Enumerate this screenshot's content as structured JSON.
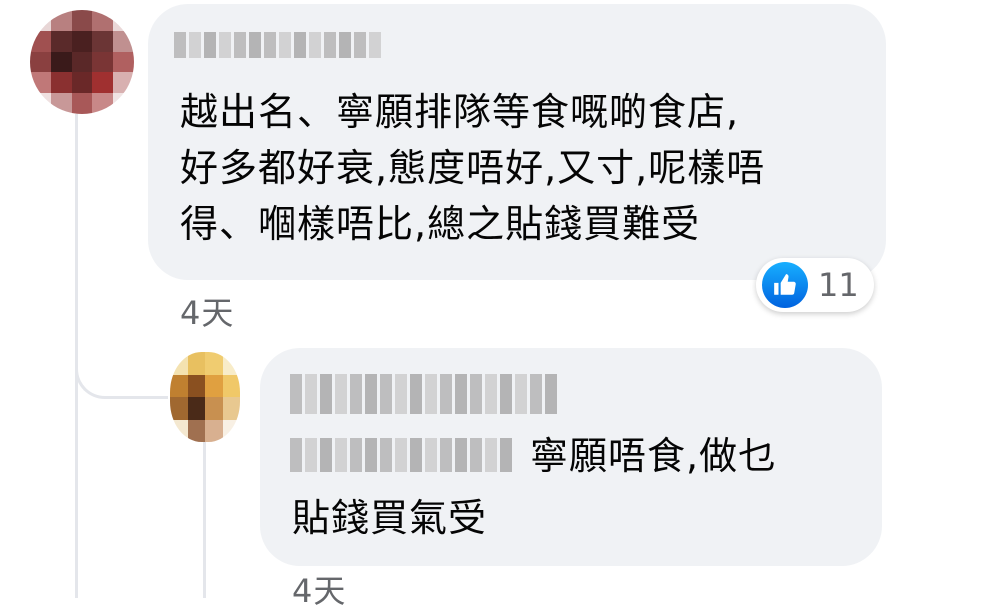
{
  "comments": [
    {
      "author": "",
      "text_lines": [
        "越出名、寧願排隊等食嘅啲食店,",
        "好多都好衰,態度唔好,又寸,呢樣唔",
        "得、嗰樣唔比,總之貼錢買難受"
      ],
      "timestamp": "4天",
      "reactions": {
        "icon": "like-icon",
        "count": "11"
      }
    },
    {
      "author": "",
      "text_lines": [
        "寧願唔食,做乜",
        "貼錢買氣受"
      ],
      "timestamp": "4天"
    }
  ],
  "colors": {
    "bubble": "#f0f2f5",
    "timestamp": "#65676b",
    "like_blue": "#1877f2",
    "thread_line": "#e4e6eb"
  }
}
